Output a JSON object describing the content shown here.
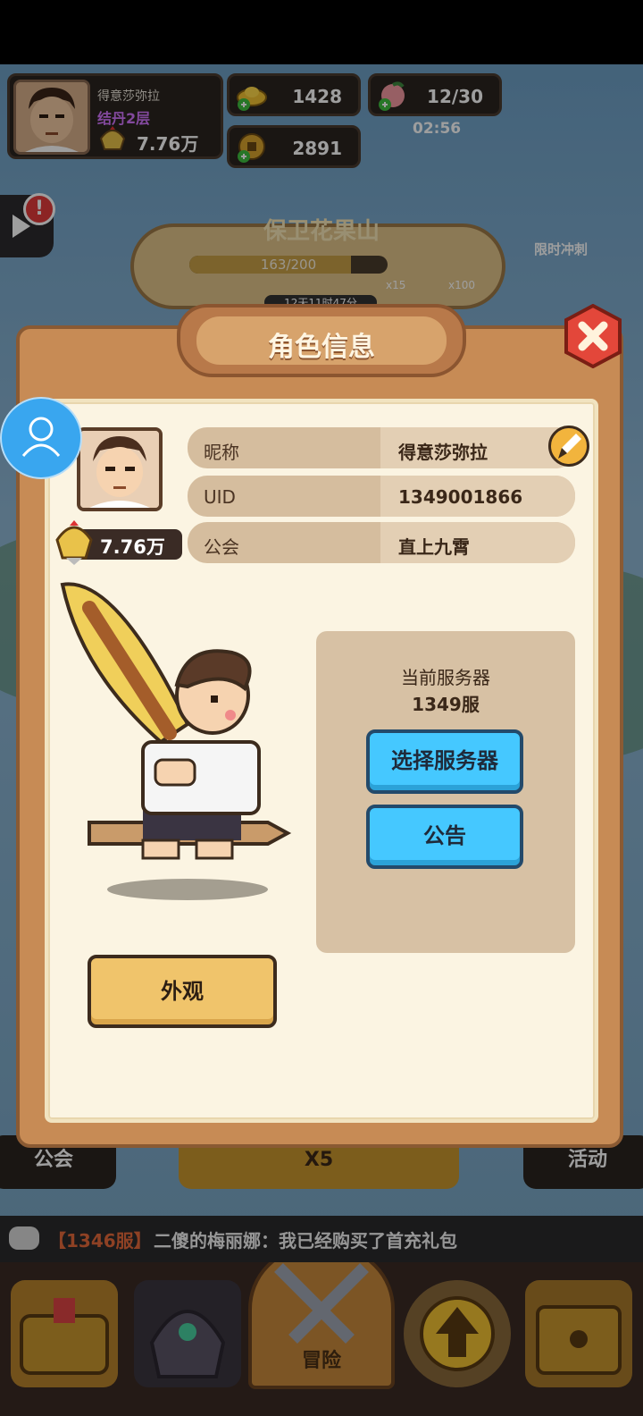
{
  "hud": {
    "player_name": "得意莎弥拉",
    "realm": "结丹2层",
    "power": "7.76万",
    "gold": "1428",
    "coins": "2891",
    "stamina": "12/30",
    "stamina_timer": "02:56"
  },
  "event": {
    "title": "保卫花果山",
    "progress_text": "163/200",
    "progress_fraction": 0.815,
    "reward_count_1": "x15",
    "reward_count_2": "x100",
    "time_left": "12天11时47分",
    "limited_label": "限时冲刺"
  },
  "modal": {
    "title": "角色信息",
    "power": "7.76万",
    "rows": [
      {
        "label": "昵称",
        "value": "得意莎弥拉"
      },
      {
        "label": "UID",
        "value": "1349001866"
      },
      {
        "label": "公会",
        "value": "直上九霄"
      }
    ],
    "server_caption": "当前服务器",
    "server_name": "1349服",
    "select_server_label": "选择服务器",
    "announcement_label": "公告",
    "appearance_label": "外观"
  },
  "scene_tabs": {
    "guild": "公会",
    "rewards": "X5",
    "activity": "活动"
  },
  "chat": {
    "server": "【1346服】",
    "message": "二傻的梅丽娜：我已经购买了首充礼包"
  },
  "nav": {
    "adventure_label": "冒险"
  },
  "icons": {
    "user": "user-icon",
    "close": "close-icon",
    "edit": "brush-icon",
    "power": "helmet-icon"
  },
  "colors": {
    "modal_frame": "#c78b55",
    "modal_inner": "#fbf4e2",
    "blue_button": "#45c8ff",
    "gold_button": "#f0c46b",
    "float_button": "#39a6ef"
  }
}
